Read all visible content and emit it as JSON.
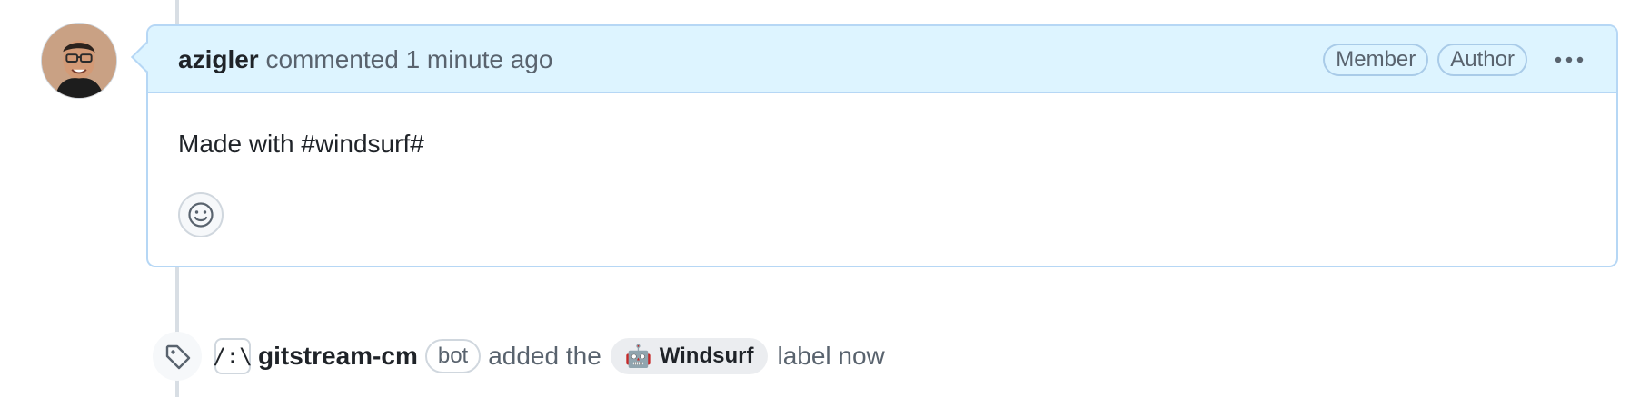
{
  "comment": {
    "author": "azigler",
    "action": "commented",
    "time": "1 minute ago",
    "badges": [
      "Member",
      "Author"
    ],
    "body": "Made with #windsurf#"
  },
  "event": {
    "bot_avatar_text": "/:\\",
    "actor": "gitstream-cm",
    "actor_badge": "bot",
    "action": "added the",
    "label_emoji": "🤖",
    "label_name": "Windsurf",
    "suffix": "label now"
  },
  "icons": {
    "menu": "kebab-horizontal-icon",
    "reaction": "smiley-icon",
    "label": "tag-icon"
  },
  "colors": {
    "header_bg": "#ddf4ff",
    "header_border": "#b6d7f5",
    "muted_text": "#59636e",
    "label_bg": "#ebedf0"
  }
}
